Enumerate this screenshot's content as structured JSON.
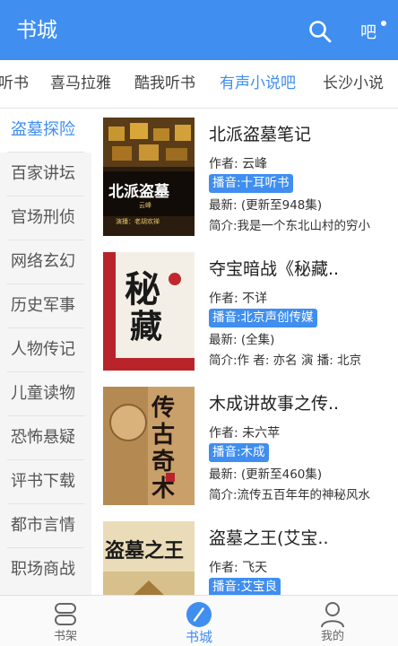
{
  "header": {
    "title": "书城",
    "search_icon": "search-icon",
    "more_icon": "more-icon"
  },
  "tabs": [
    {
      "label": "听书"
    },
    {
      "label": "喜马拉雅"
    },
    {
      "label": "酷我听书"
    },
    {
      "label": "有声小说吧",
      "active": true
    },
    {
      "label": "长沙小说"
    }
  ],
  "sidebar": {
    "items": [
      {
        "label": "盗墓探险",
        "active": true
      },
      {
        "label": "百家讲坛"
      },
      {
        "label": "官场刑侦"
      },
      {
        "label": "网络玄幻"
      },
      {
        "label": "历史军事"
      },
      {
        "label": "人物传记"
      },
      {
        "label": "儿童读物"
      },
      {
        "label": "恐怖悬疑"
      },
      {
        "label": "评书下载"
      },
      {
        "label": "都市言情"
      },
      {
        "label": "职场商战"
      }
    ]
  },
  "books": [
    {
      "title": "北派盗墓笔记",
      "author": "作者: 云峰",
      "tag": "播音:十耳听书",
      "latest": "最新: (更新至948集)",
      "intro": "简介:我是一个东北山村的穷小",
      "cover_text": [
        "北派盗墓",
        "云峰",
        "演播：老胡欢禅"
      ]
    },
    {
      "title": "夺宝暗战《秘藏..",
      "author": "作者: 不详",
      "tag": "播音:北京声创传媒",
      "latest": "最新: (全集)",
      "intro": "简介:作 者: 亦名 演 播: 北京",
      "cover_text": [
        "秘",
        "藏"
      ]
    },
    {
      "title": "木成讲故事之传..",
      "author": "作者: 未六苹",
      "tag": "播音:木成",
      "latest": "最新: (更新至460集)",
      "intro": "简介:流传五百年年的神秘风水",
      "cover_text": [
        "传",
        "古",
        "奇",
        "术"
      ]
    },
    {
      "title": "盗墓之王(艾宝..",
      "author": "作者: 飞天",
      "tag": "播音:艾宝良",
      "cover_text": [
        "盗墓之王"
      ]
    }
  ],
  "bottom_nav": [
    {
      "label": "书架",
      "icon": "bookshelf-icon"
    },
    {
      "label": "书城",
      "icon": "compass-icon",
      "active": true
    },
    {
      "label": "我的",
      "icon": "profile-icon"
    }
  ],
  "colors": {
    "accent": "#3f8ef0",
    "tag_bg": "#3f8ef0",
    "sidebar_bg": "#f5f5f5"
  }
}
